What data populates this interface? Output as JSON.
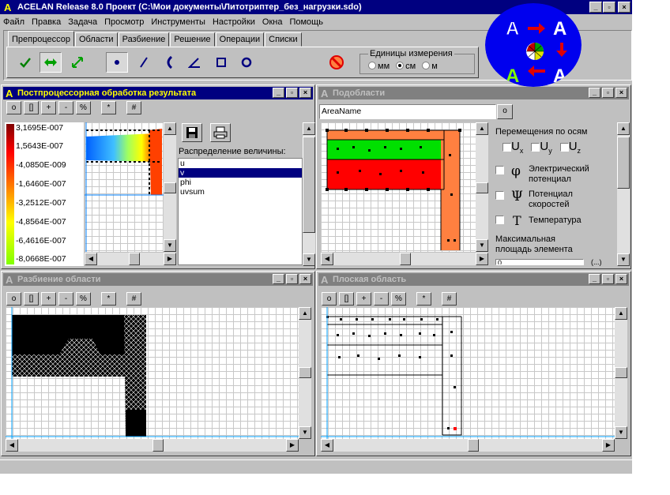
{
  "app": {
    "title": "ACELAN Release 8.0 Проект (C:\\Мои документы\\Литотриптер_без_нагрузки.sdo)",
    "window_buttons": [
      "_",
      "▫",
      "×"
    ]
  },
  "menu": [
    "Файл",
    "Правка",
    "Задача",
    "Просмотр",
    "Инструменты",
    "Настройки",
    "Окна",
    "Помощь"
  ],
  "tabs": [
    "Препроцессор",
    "Области",
    "Разбиение",
    "Решение",
    "Операции",
    "Списки"
  ],
  "active_tab": "Препроцессор",
  "units": {
    "label": "Единицы измерения",
    "options": [
      "мм",
      "см",
      "м"
    ],
    "selected": "см"
  },
  "mini_toolbar": [
    "o",
    "[]",
    "+",
    "-",
    "%",
    "*",
    "#"
  ],
  "post_panel": {
    "title": "Постпроцессорная обработка результата",
    "legend": [
      "3,1695E-007",
      "1,5643E-007",
      "-4,0850E-009",
      "-1,6460E-007",
      "-3,2512E-007",
      "-4,8564E-007",
      "-6,4616E-007",
      "-8,0668E-007"
    ],
    "dist_label": "Распределение величины:",
    "quantities": [
      "u",
      "v",
      "phi",
      "uvsum"
    ],
    "selected_quantity": "v"
  },
  "sub_panel": {
    "title": "Подобласти",
    "field_value": "AreaName",
    "field_button": "o",
    "axes_label": "Перемещения по осям",
    "axes": [
      "U",
      "U",
      "U"
    ],
    "axes_sub": [
      "x",
      "y",
      "z"
    ],
    "props": [
      {
        "symbol": "φ",
        "label1": "Электрический",
        "label2": "потенциал"
      },
      {
        "symbol": "Ψ",
        "label1": "Потенциал",
        "label2": "скоростей"
      },
      {
        "symbol": "T",
        "label1": "Температура",
        "label2": ""
      }
    ],
    "max_area_label1": "Максимальная",
    "max_area_label2": "площадь элемента",
    "max_area_value": "0",
    "max_area_suffix": "(...)"
  },
  "mesh_panel": {
    "title": "Разбиение области"
  },
  "plane_panel": {
    "title": "Плоская область"
  },
  "colors": {
    "title_active": "#000080",
    "title_inactive": "#808080",
    "region_orange": "#ff8040",
    "region_green": "#00e000",
    "region_red": "#ff0000"
  }
}
